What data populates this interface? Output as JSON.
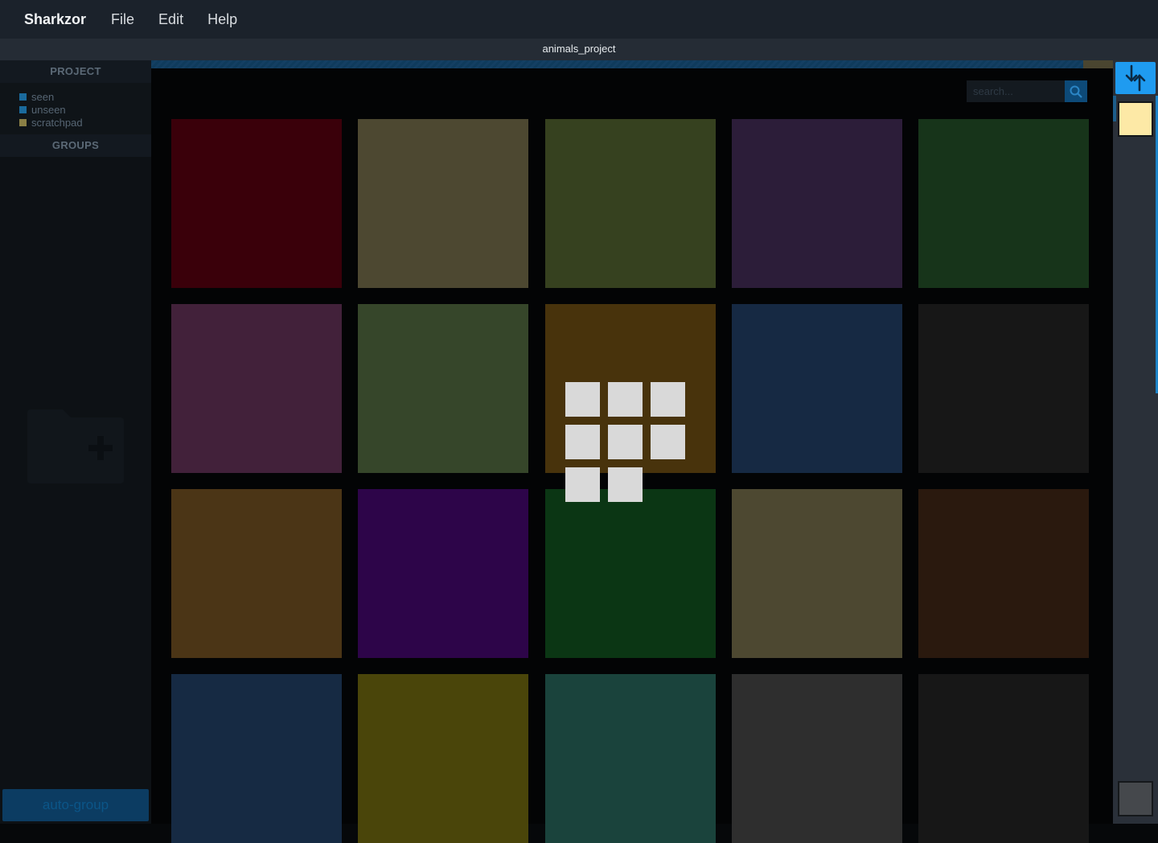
{
  "app": {
    "name": "Sharkzor",
    "menu": [
      "File",
      "Edit",
      "Help"
    ]
  },
  "project": {
    "title": "animals_project"
  },
  "sidebar": {
    "project_header": "PROJECT",
    "project_items": [
      {
        "label": "seen",
        "color": "#1a6a9c"
      },
      {
        "label": "unseen",
        "color": "#1a6a9c"
      },
      {
        "label": "scratchpad",
        "color": "#8a7f45"
      }
    ],
    "groups_header": "GROUPS",
    "add_group_icon": "folder-plus-icon",
    "auto_group_label": "auto-group"
  },
  "search": {
    "placeholder": "search..."
  },
  "tiles": [
    {
      "color": "#3a000a"
    },
    {
      "color": "#4d4831"
    },
    {
      "color": "#36411f"
    },
    {
      "color": "#2c1d39"
    },
    {
      "color": "#17341a"
    },
    {
      "color": "#42213a"
    },
    {
      "color": "#36462a"
    },
    {
      "color": "#48330c"
    },
    {
      "color": "#162943"
    },
    {
      "color": "#171717"
    },
    {
      "color": "#4b3516"
    },
    {
      "color": "#2d0549"
    },
    {
      "color": "#0b3614"
    },
    {
      "color": "#4d4831"
    },
    {
      "color": "#2a190e"
    },
    {
      "color": "#162a43"
    },
    {
      "color": "#4a450a"
    },
    {
      "color": "#1a433c"
    },
    {
      "color": "#2e2e2e"
    },
    {
      "color": "#171717"
    }
  ],
  "drag_selection_count": 8,
  "rightbar": {
    "toggle_icon": "swap-vertical-icon",
    "swatch_top_color": "#fde9a6",
    "swatch_bottom_color": "#45484c"
  }
}
